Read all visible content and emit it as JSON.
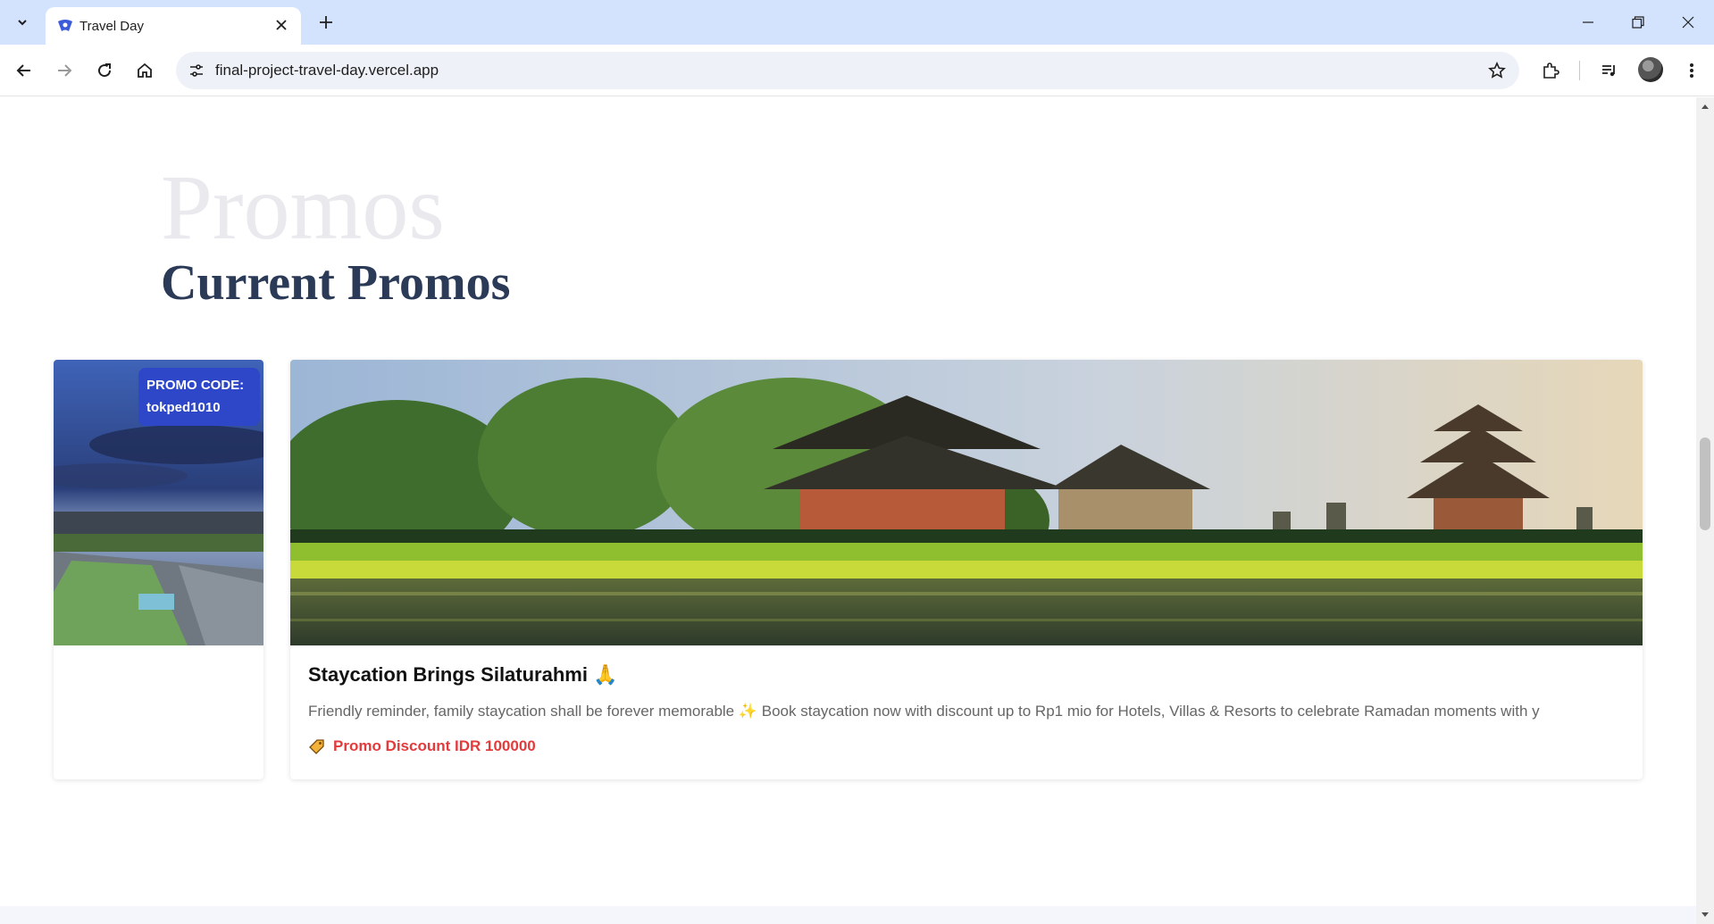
{
  "browser": {
    "tab_title": "Travel Day",
    "url": "final-project-travel-day.vercel.app"
  },
  "page": {
    "background_word": "Promos",
    "section_title": "Current Promos"
  },
  "promos": {
    "left_card": {
      "promo_code_label": "PROMO CODE:",
      "promo_code": "tokped1010"
    },
    "main_card": {
      "title": "Staycation Brings Silaturahmi 🙏",
      "description": "Friendly reminder, family staycation shall be forever memorable ✨ Book staycation now with discount up to Rp1 mio for Hotels, Villas & Resorts to celebrate Ramadan moments with y",
      "discount": "Promo Discount IDR 100000"
    }
  },
  "colors": {
    "title": "#2b3a57",
    "badge": "#2d47c8",
    "discount": "#e33b3b",
    "tabbar": "#d3e3fd"
  }
}
